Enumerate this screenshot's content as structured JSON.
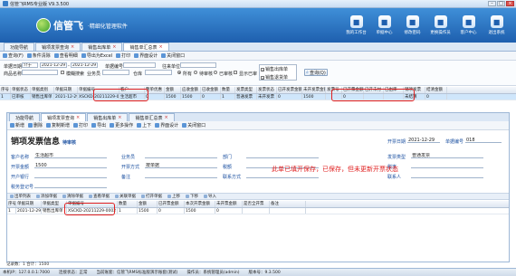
{
  "app": {
    "title": "信管飞RMS专业版 V9.3.500"
  },
  "brand": {
    "name": "信管飞",
    "slogan": "·精细化管理软件"
  },
  "nav": [
    {
      "label": "我的工作台",
      "icon": "desk-icon"
    },
    {
      "label": "单据中心",
      "icon": "document-icon"
    },
    {
      "label": "修改密码",
      "icon": "key-icon"
    },
    {
      "label": "更换操作员",
      "icon": "user-switch-icon"
    },
    {
      "label": "客户中心",
      "icon": "people-icon"
    },
    {
      "label": "退出系统",
      "icon": "exit-icon"
    }
  ],
  "tabs": [
    "功能导航",
    "销项发票查询",
    "销售出库单",
    "销售单汇总表"
  ],
  "toolbar": [
    "查询(F)",
    "条件清除",
    "查看明细",
    "导出为Excel",
    "打印",
    "界面设计",
    "关闭窗口"
  ],
  "filter": {
    "date_label": "单据日期",
    "date_op": "介于",
    "date_from": "2021-12-29",
    "date_to": "2021-12-29",
    "doc_no_label": "单据编号",
    "settle_label": "往来单位",
    "goods_label": "商品名称",
    "fuzzy_label": "模糊搜索",
    "dept_label": "业务员",
    "warehouse_label": "仓库",
    "all_label": "所有",
    "audit_label": "待审核",
    "audited_label": "已审核",
    "show_label": "显示已审",
    "doc_types": [
      "销售出库单",
      "销售退货单"
    ],
    "query_button": "查询(Q)"
  },
  "grid1": {
    "headers": [
      "序号",
      "单据状态",
      "单据类别",
      "单据日期",
      "单据编号",
      "客户",
      "整单优惠",
      "金额",
      "应收金额",
      "已收金额",
      "数量",
      "发票类型",
      "发票状态",
      "已开发票金额",
      "未开发票金额",
      "发票号",
      "已开票金额",
      "已开未付",
      "已出库",
      "销项发票",
      "结清金额"
    ],
    "row": [
      "1",
      "已审核",
      "销售出库单",
      "2021-12-29",
      "XSCKD-20211229-0002",
      "生活超市",
      "0",
      "1500",
      "1500",
      "0",
      "1",
      "普通发票",
      "未开发票",
      "0",
      "1500",
      "",
      "0",
      "",
      "",
      "未结算",
      "0"
    ]
  },
  "inner": {
    "tabs": [
      "功能导航",
      "销项发票查询",
      "销售出库单",
      "销售单汇总表"
    ],
    "toolbar": [
      "新增",
      "删除",
      "复制新增",
      "打印",
      "导出",
      "更多操作",
      "上下",
      "界面设计",
      "关闭窗口"
    ],
    "title": "销项发票信息",
    "subtitle": "待审核",
    "doc_date_label": "开票日期",
    "doc_date": "2021-12-29",
    "doc_no_label": "单据编号",
    "doc_no": "018",
    "fields": [
      {
        "label": "客户名称",
        "value": "生活超市"
      },
      {
        "label": "业务员",
        "value": ""
      },
      {
        "label": "部门",
        "value": ""
      },
      {
        "label": "发票类型",
        "value": "普通发票"
      },
      {
        "label": "开票金额",
        "value": "1500"
      },
      {
        "label": "开票方式",
        "value": "按单据"
      },
      {
        "label": "税额",
        "value": ""
      },
      {
        "label": "税率",
        "value": ""
      },
      {
        "label": "开户银行",
        "value": ""
      },
      {
        "label": "备注",
        "value": ""
      },
      {
        "label": "联系方式",
        "value": ""
      },
      {
        "label": "联系人",
        "value": ""
      },
      {
        "label": "税务登记号",
        "value": ""
      }
    ],
    "note": "此单已填开保存，已保存，但未更新开票状态",
    "subtabs": [
      "出单列表",
      "添加单据",
      "清除单据",
      "查看单据",
      "关联单据",
      "打开单据",
      "上移",
      "下移",
      "导入"
    ],
    "grid_headers": [
      "序号",
      "单据日期",
      "单据类型",
      "单据编号",
      "数量",
      "金额",
      "已开票金额",
      "本次开票金额",
      "未开票金额",
      "是否全开票",
      "备注"
    ],
    "grid_row": [
      "1",
      "2021-12-29",
      "销售出库单",
      "XSCKD-20211229-0002",
      "1",
      "1500",
      "0",
      "1500",
      "0",
      "",
      ""
    ]
  },
  "footer_info": "记录数：1  合计：1500",
  "status": {
    "ip": "本机IP：127.0.0.1:7000",
    "conn": "连接状态：正常",
    "user": "操作员：系统管理员(admin)",
    "account": "当前账套：信管飞RMS标准版演示账套(测试)",
    "version": "版本号：9.3.500"
  }
}
